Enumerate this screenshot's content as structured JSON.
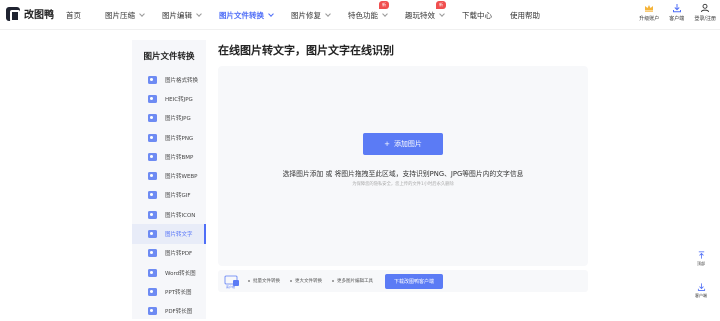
{
  "brand": {
    "name": "改图鸭"
  },
  "nav": [
    {
      "label": "首页",
      "dropdown": false,
      "active": false
    },
    {
      "label": "图片压缩",
      "dropdown": true,
      "active": false
    },
    {
      "label": "图片编辑",
      "dropdown": true,
      "active": false
    },
    {
      "label": "图片文件转换",
      "dropdown": true,
      "active": true
    },
    {
      "label": "图片修复",
      "dropdown": true,
      "active": false
    },
    {
      "label": "特色功能",
      "dropdown": true,
      "active": false,
      "badge": "新"
    },
    {
      "label": "趣玩特效",
      "dropdown": true,
      "active": false,
      "badge": "新"
    },
    {
      "label": "下载中心",
      "dropdown": false,
      "active": false
    },
    {
      "label": "使用帮助",
      "dropdown": false,
      "active": false
    }
  ],
  "header_right": [
    {
      "label": "升级账户",
      "icon": "crown-icon"
    },
    {
      "label": "客户端",
      "icon": "download-icon"
    },
    {
      "label": "登录/注册",
      "icon": "user-icon"
    }
  ],
  "sidebar": {
    "title": "图片文件转换",
    "items": [
      {
        "label": "图片格式转换",
        "active": false
      },
      {
        "label": "HEIC转JPG",
        "active": false
      },
      {
        "label": "图片转JPG",
        "active": false
      },
      {
        "label": "图片转PNG",
        "active": false
      },
      {
        "label": "图片转BMP",
        "active": false
      },
      {
        "label": "图片转WEBP",
        "active": false
      },
      {
        "label": "图片转GIF",
        "active": false
      },
      {
        "label": "图片转ICON",
        "active": false
      },
      {
        "label": "图片转文字",
        "active": true
      },
      {
        "label": "图片转PDF",
        "active": false
      },
      {
        "label": "Word转长图",
        "active": false
      },
      {
        "label": "PPT转长图",
        "active": false
      },
      {
        "label": "PDF转长图",
        "active": false
      }
    ]
  },
  "main": {
    "title": "在线图片转文字，图片文字在线识别",
    "add_button": "添加图片",
    "upload_text": "选择图片添加 或 将图片拖拽至此区域，支持识别PNG、JPG等图片内的文字信息",
    "upload_subtext": "为保障您的隐私安全，您上传的文件1小时后永久删除"
  },
  "bottom_bar": {
    "icon_label": "客户端",
    "features": [
      "批量文件转换",
      "更大文件转换",
      "更多图片编辑工具"
    ],
    "button": "下载改图鸭客户端"
  },
  "float": [
    {
      "label": "顶部",
      "icon": "to-top-icon"
    },
    {
      "label": "客户端",
      "icon": "download-icon"
    }
  ],
  "colors": {
    "accent": "#5b7bf5",
    "badge": "#f04f4f"
  }
}
